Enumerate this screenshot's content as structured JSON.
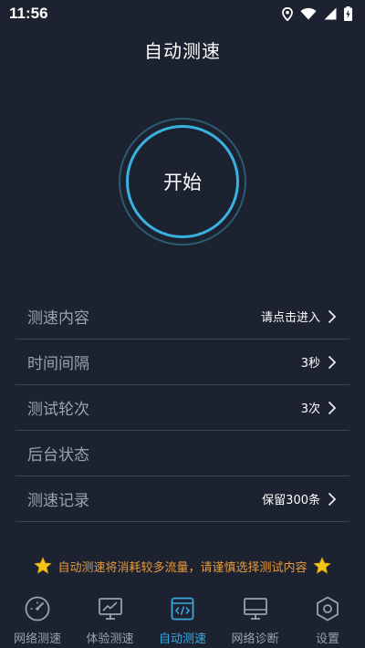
{
  "status_bar": {
    "time": "11:56",
    "icons": [
      "location-icon",
      "wifi-icon",
      "signal-icon",
      "battery-charging-icon"
    ]
  },
  "header": {
    "title": "自动测速"
  },
  "start": {
    "label": "开始"
  },
  "settings": [
    {
      "label": "测速内容",
      "value": "请点击进入",
      "chevron": true
    },
    {
      "label": "时间间隔",
      "value": "3秒",
      "chevron": true
    },
    {
      "label": "测试轮次",
      "value": "3次",
      "chevron": true
    },
    {
      "label": "后台状态",
      "value": "",
      "chevron": false
    },
    {
      "label": "测速记录",
      "value": "保留300条",
      "chevron": true
    }
  ],
  "warning": {
    "text": "自动测速将消耗较多流量，请谨慎选择测试内容"
  },
  "nav": {
    "items": [
      {
        "label": "网络测速",
        "icon": "speedometer-icon",
        "active": false
      },
      {
        "label": "体验测速",
        "icon": "monitor-chart-icon",
        "active": false
      },
      {
        "label": "自动测速",
        "icon": "code-window-icon",
        "active": true
      },
      {
        "label": "网络诊断",
        "icon": "monitor-icon",
        "active": false
      },
      {
        "label": "设置",
        "icon": "hexagon-gear-icon",
        "active": false
      }
    ]
  },
  "colors": {
    "background": "#1d2230",
    "accent": "#39a9e0",
    "warning": "#e59a3c",
    "star": "#f5c518",
    "muted": "#9aa1b0"
  }
}
